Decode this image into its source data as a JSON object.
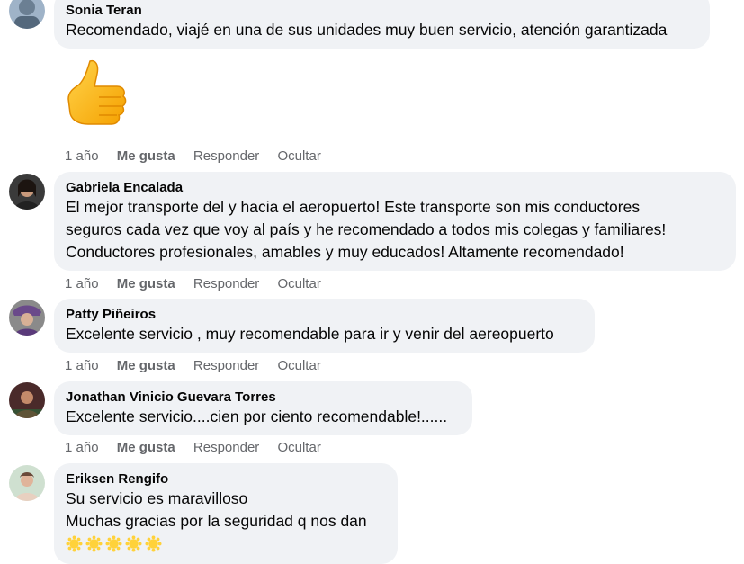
{
  "comments": [
    {
      "author": "Sonia Teran",
      "lines": [
        "Recomendado, viajé en una de sus unidades muy buen servicio, atención garantizada"
      ],
      "actions": {
        "time": "1 año",
        "like": "Me gusta",
        "reply": "Responder",
        "hide": "Ocultar"
      },
      "sticker": "thumbs-up-icon"
    },
    {
      "author": "Gabriela Encalada",
      "lines": [
        "El mejor transporte del y hacia el aeropuerto! Este transporte son mis conductores",
        "seguros cada vez que voy al país y he recomendado a todos mis colegas y familiares!",
        "Conductores profesionales, amables y muy educados! Altamente recomendado!"
      ],
      "actions": {
        "time": "1 año",
        "like": "Me gusta",
        "reply": "Responder",
        "hide": "Ocultar"
      }
    },
    {
      "author": "Patty Piñeiros",
      "lines": [
        "Excelente servicio , muy recomendable para ir y venir del aereopuerto"
      ],
      "actions": {
        "time": "1 año",
        "like": "Me gusta",
        "reply": "Responder",
        "hide": "Ocultar"
      }
    },
    {
      "author": "Jonathan Vinicio Guevara Torres",
      "lines": [
        "Excelente servicio....cien por ciento recomendable!......"
      ],
      "actions": {
        "time": "1 año",
        "like": "Me gusta",
        "reply": "Responder",
        "hide": "Ocultar"
      }
    },
    {
      "author": "Eriksen Rengifo",
      "lines": [
        "Su servicio es maravilloso",
        "Muchas gracias por la seguridad q nos dan"
      ],
      "emoji": [
        "sun-icon",
        "sun-icon",
        "sun-icon",
        "sun-icon",
        "sun-icon"
      ]
    }
  ],
  "colors": {
    "bubble": "#f0f2f5",
    "text": "#050505",
    "meta": "#65676b"
  }
}
